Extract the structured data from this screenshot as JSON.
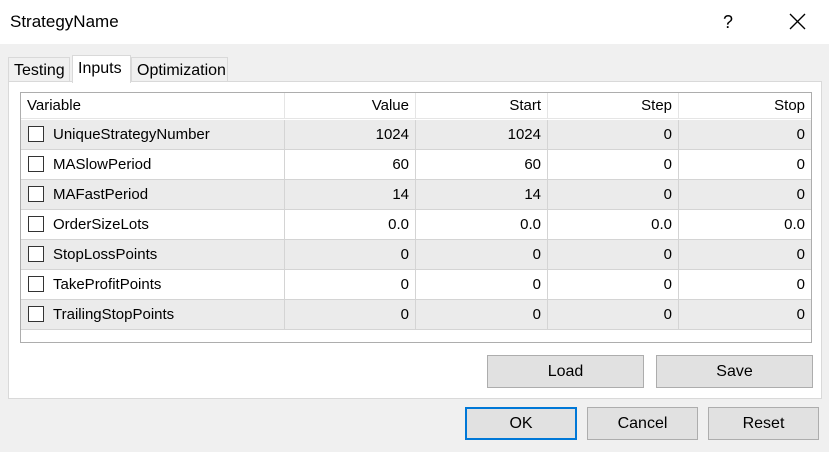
{
  "window": {
    "title": "StrategyName",
    "help_glyph": "?"
  },
  "tabs": [
    {
      "label": "Testing"
    },
    {
      "label": "Inputs"
    },
    {
      "label": "Optimization"
    }
  ],
  "grid": {
    "columns": [
      "Variable",
      "Value",
      "Start",
      "Step",
      "Stop"
    ],
    "rows": [
      {
        "name": "UniqueStrategyNumber",
        "value": "1024",
        "start": "1024",
        "step": "0",
        "stop": "0"
      },
      {
        "name": "MASlowPeriod",
        "value": "60",
        "start": "60",
        "step": "0",
        "stop": "0"
      },
      {
        "name": "MAFastPeriod",
        "value": "14",
        "start": "14",
        "step": "0",
        "stop": "0"
      },
      {
        "name": "OrderSizeLots",
        "value": "0.0",
        "start": "0.0",
        "step": "0.0",
        "stop": "0.0"
      },
      {
        "name": "StopLossPoints",
        "value": "0",
        "start": "0",
        "step": "0",
        "stop": "0"
      },
      {
        "name": "TakeProfitPoints",
        "value": "0",
        "start": "0",
        "step": "0",
        "stop": "0"
      },
      {
        "name": "TrailingStopPoints",
        "value": "0",
        "start": "0",
        "step": "0",
        "stop": "0"
      }
    ]
  },
  "buttons": {
    "load": "Load",
    "save": "Save",
    "ok": "OK",
    "cancel": "Cancel",
    "reset": "Reset"
  },
  "colors": {
    "accent": "#0078d7",
    "alt_row": "#ebebeb"
  }
}
